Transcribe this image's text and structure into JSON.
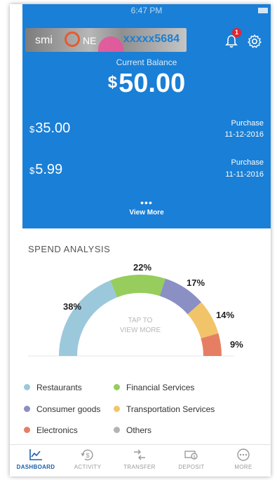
{
  "status_bar": {
    "time": "6:47 PM"
  },
  "card": {
    "logo_prefix": "smi",
    "logo_suffix": "NE",
    "number": "xxxxx5684"
  },
  "notifications": {
    "badge_count": "1"
  },
  "balance": {
    "label": "Current Balance",
    "currency": "$",
    "amount": "50.00"
  },
  "transactions": [
    {
      "currency": "$",
      "amount": "35.00",
      "type": "Purchase",
      "date": "11-12-2016"
    },
    {
      "currency": "$",
      "amount": "5.99",
      "type": "Purchase",
      "date": "11-11-2016"
    }
  ],
  "view_more": {
    "dots": "•••",
    "label": "View More"
  },
  "spend": {
    "title": "SPEND ANALYSIS",
    "tap_line1": "TAP TO",
    "tap_line2": "VIEW MORE"
  },
  "chart_data": {
    "type": "pie",
    "segments": [
      {
        "category": "Restaurants",
        "percent": 38,
        "label": "38%",
        "color": "#9cc8dc"
      },
      {
        "category": "Financial Services",
        "percent": 22,
        "label": "22%",
        "color": "#96cd5c"
      },
      {
        "category": "Consumer goods",
        "percent": 17,
        "label": "17%",
        "color": "#8a8fc4"
      },
      {
        "category": "Transportation Services",
        "percent": 14,
        "label": "14%",
        "color": "#f2c46a"
      },
      {
        "category": "Electronics",
        "percent": 9,
        "label": "9%",
        "color": "#e67e63"
      }
    ],
    "legend": [
      {
        "name": "Restaurants",
        "color": "#9cc8dc"
      },
      {
        "name": "Financial Services",
        "color": "#96cd5c"
      },
      {
        "name": "Consumer goods",
        "color": "#8a8fc4"
      },
      {
        "name": "Transportation Services",
        "color": "#f2c46a"
      },
      {
        "name": "Electronics",
        "color": "#e67e63"
      },
      {
        "name": "Others",
        "color": "#b3b3b3"
      }
    ],
    "legend_position": "bottom"
  },
  "tabs": [
    {
      "label": "DASHBOARD",
      "icon": "dashboard-chart-icon",
      "active": true
    },
    {
      "label": "ACTIVITY",
      "icon": "activity-dollar-icon",
      "active": false
    },
    {
      "label": "TRANSFER",
      "icon": "transfer-icon",
      "active": false
    },
    {
      "label": "DEPOSIT",
      "icon": "deposit-check-icon",
      "active": false
    },
    {
      "label": "MORE",
      "icon": "more-dots-icon",
      "active": false
    }
  ],
  "colors": {
    "brand_blue": "#1a7fd6",
    "active_tab": "#1a5fa8",
    "badge_red": "#e8232a"
  }
}
